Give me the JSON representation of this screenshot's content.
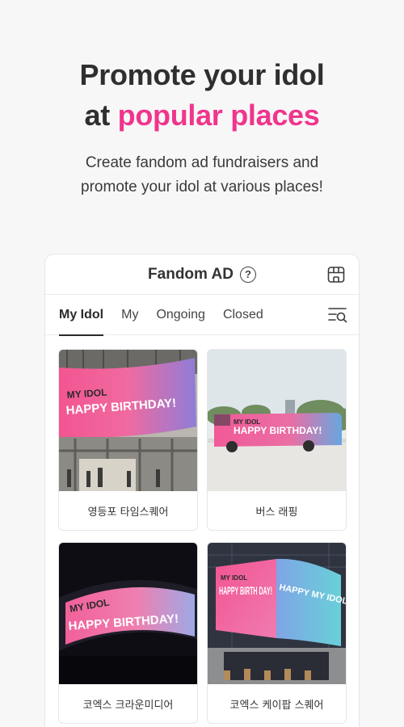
{
  "hero": {
    "title_line1": "Promote your idol",
    "title_line2_prefix": "at ",
    "title_line2_accent": "popular places",
    "subtitle_line1": "Create fandom ad fundraisers and",
    "subtitle_line2": "promote your idol at various places!"
  },
  "card": {
    "title": "Fandom AD",
    "help_glyph": "?",
    "tabs": [
      {
        "label": "My Idol",
        "active": true
      },
      {
        "label": "My",
        "active": false
      },
      {
        "label": "Ongoing",
        "active": false
      },
      {
        "label": "Closed",
        "active": false
      }
    ],
    "items": [
      {
        "label": "영등포 타임스퀘어",
        "ad_line1": "MY IDOL",
        "ad_line2": "HAPPY BIRTHDAY!"
      },
      {
        "label": "버스 래핑",
        "ad_line1": "MY IDOL",
        "ad_line2": "HAPPY BIRTHDAY!"
      },
      {
        "label": "코엑스 크라운미디어",
        "ad_line1": "MY IDOL",
        "ad_line2": "HAPPY BIRTHDAY!"
      },
      {
        "label": "코엑스 케이팝 스퀘어",
        "ad_line1": "MY IDOL",
        "ad_line2": "HAPPY BIRTH DAY!",
        "ad_side": "HAPPY MY IDOL DAY"
      }
    ]
  },
  "colors": {
    "accent": "#f0358c",
    "text": "#2f2f2f",
    "background": "#f7f7f8"
  },
  "icons": {
    "help": "question-circle-icon",
    "shop": "storefront-icon",
    "filter": "filter-search-icon"
  }
}
